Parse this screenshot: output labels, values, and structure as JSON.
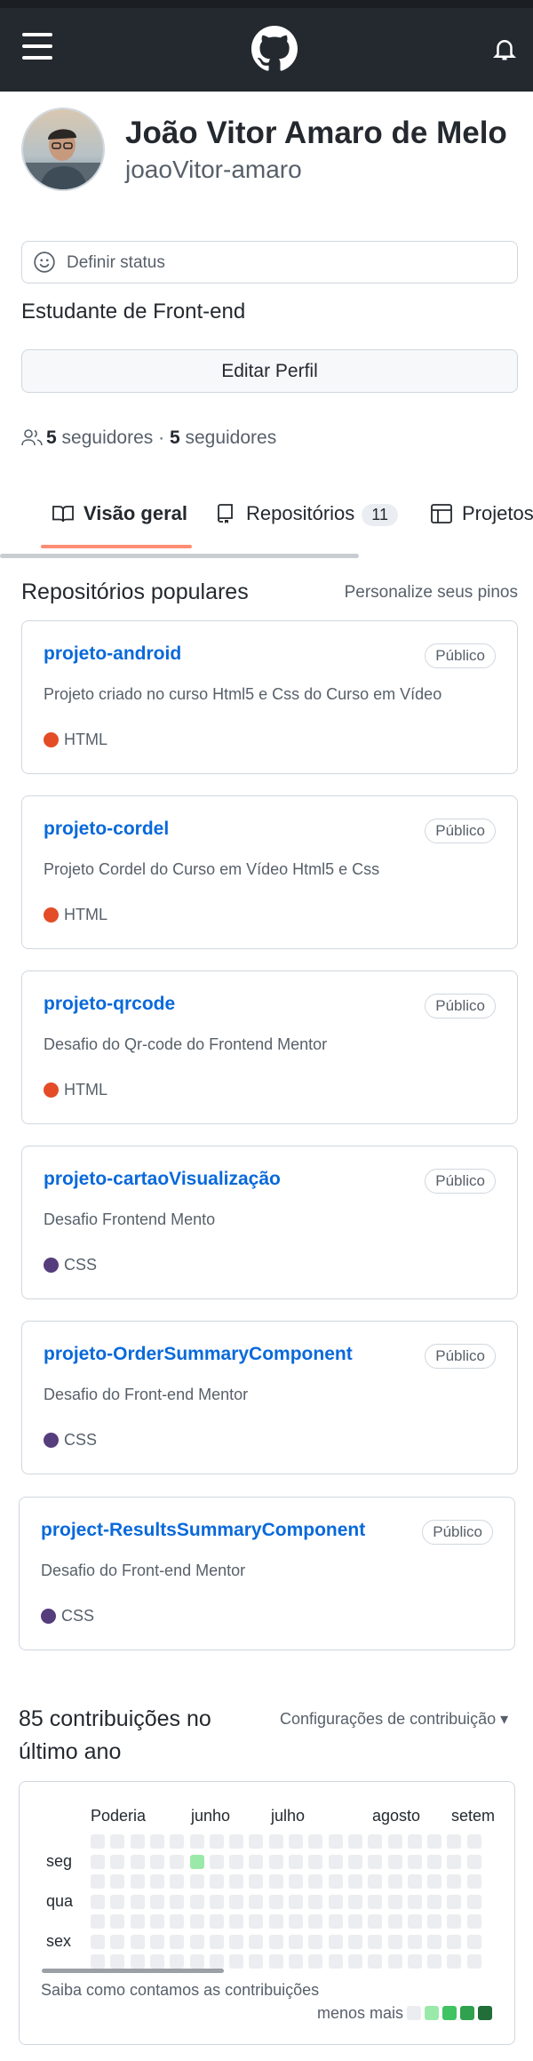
{
  "header": {
    "menu_icon": "hamburger-menu-icon",
    "logo_icon": "github-logo-icon",
    "notifications_icon": "bell-icon"
  },
  "profile": {
    "full_name": "João Vitor Amaro de Melo",
    "login": "joaoVitor-amaro",
    "status_placeholder": "Definir status",
    "bio": "Estudante de Front-end",
    "edit_button": "Editar Perfil",
    "followers_count": "5",
    "followers_label": "seguidores",
    "separator": " · ",
    "following_count": "5",
    "following_label": "seguidores"
  },
  "tabs": [
    {
      "label": "Visão geral",
      "icon": "book-icon",
      "active": true
    },
    {
      "label": "Repositórios",
      "icon": "repo-icon",
      "count": "11"
    },
    {
      "label": "Projetos",
      "icon": "table-icon"
    }
  ],
  "pinned": {
    "title": "Repositórios populares",
    "customize_link": "Personalize seus pinos",
    "repos": [
      {
        "name": "projeto-android",
        "visibility": "Público",
        "description": "Projeto criado no curso Html5 e Css do Curso em Vídeo",
        "language": "HTML",
        "language_color": "#e34c26"
      },
      {
        "name": "projeto-cordel",
        "visibility": "Público",
        "description": "Projeto Cordel do Curso em Vídeo Html5 e Css",
        "language": "HTML",
        "language_color": "#e34c26"
      },
      {
        "name": "projeto-qrcode",
        "visibility": "Público",
        "description": "Desafio do Qr-code do Frontend Mentor",
        "language": "HTML",
        "language_color": "#e34c26"
      },
      {
        "name": "projeto-cartaoVisualização",
        "visibility": "Público",
        "description": "Desafio Frontend Mento",
        "language": "CSS",
        "language_color": "#563d7c"
      },
      {
        "name": "projeto-OrderSummaryComponent",
        "visibility": "Público",
        "description": "Desafio do Front-end Mentor",
        "language": "CSS",
        "language_color": "#563d7c"
      },
      {
        "name": "project-ResultsSummaryComponent",
        "visibility": "Público",
        "description": "Desafio do Front-end Mentor",
        "language": "CSS",
        "language_color": "#563d7c"
      }
    ]
  },
  "contributions": {
    "title": "85 contribuições no último ano",
    "settings_link": "Configurações de contribuição",
    "months": [
      "Poderia",
      "junho",
      "julho",
      "agosto",
      "setem"
    ],
    "days": [
      "seg",
      "qua",
      "sex"
    ],
    "learn_link": "Saiba como contamos as contribuições",
    "legend_less": "menos",
    "legend_more": "mais",
    "legend_colors": [
      "#ebedf0",
      "#9be9a8",
      "#40c463",
      "#30a14e",
      "#216e39"
    ],
    "highlighted_cell": {
      "week": 5,
      "day": "seg",
      "color": "#9be9a8"
    }
  }
}
